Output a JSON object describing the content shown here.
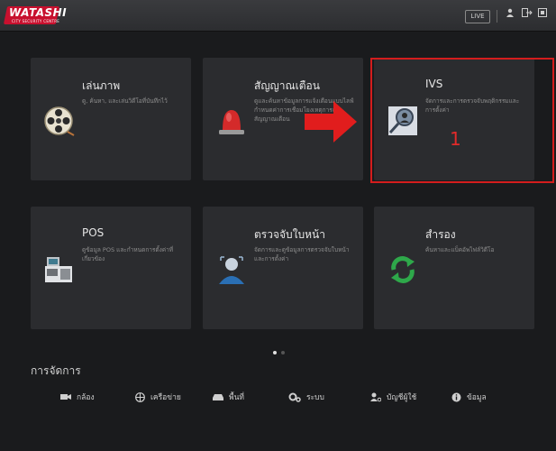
{
  "header": {
    "logo": "WATASHI",
    "logo_sub": "CITY SECURITY CENTRE",
    "live_button": "LIVE",
    "icons": [
      "user-icon",
      "logout-icon",
      "fullscreen-icon"
    ]
  },
  "cards": [
    {
      "title": "เล่นภาพ",
      "desc": "ดู, ค้นหา, และเล่นวิดีโอที่บันทึกไว้",
      "icon": "film-reel-icon"
    },
    {
      "title": "สัญญาณเตือน",
      "desc": "ดูและค้นหาข้อมูลการแจ้งเตือนแบบไลฟ์ กำหนดค่าการเชื่อมโยงเหตุการณ์สัญญาณเตือน",
      "icon": "alarm-siren-icon"
    },
    {
      "title": "IVS",
      "desc": "จัดการและการตรวจจับพฤติกรรมและการตั้งค่า",
      "icon": "magnifier-person-icon"
    },
    {
      "title": "POS",
      "desc": "ดูข้อมูล POS และกำหนดการตั้งค่าที่เกี่ยวข้อง",
      "icon": "pos-terminal-icon"
    },
    {
      "title": "ตรวจจับใบหน้า",
      "desc": "จัดการและดูข้อมูลการตรวจจับใบหน้าและการตั้งค่า",
      "icon": "face-detection-icon"
    },
    {
      "title": "สำรอง",
      "desc": "ค้นหาและแบ็คอัพไฟล์วิดีโอ",
      "icon": "backup-refresh-icon"
    }
  ],
  "annotation": {
    "step_number": "1",
    "highlight_color": "#d41d1d"
  },
  "pager": {
    "active": 0,
    "count": 2
  },
  "management": {
    "title": "การจัดการ",
    "items": [
      {
        "label": "กล้อง",
        "icon": "camera-icon"
      },
      {
        "label": "เครือข่าย",
        "icon": "network-icon"
      },
      {
        "label": "พื้นที่",
        "icon": "storage-icon"
      },
      {
        "label": "ระบบ",
        "icon": "settings-icon"
      },
      {
        "label": "บัญชีผู้ใช้",
        "icon": "account-icon"
      },
      {
        "label": "ข้อมูล",
        "icon": "info-icon"
      }
    ]
  },
  "colors": {
    "background": "#1a1b1d",
    "card": "#2b2c2f",
    "accent_red": "#d41d1d"
  }
}
